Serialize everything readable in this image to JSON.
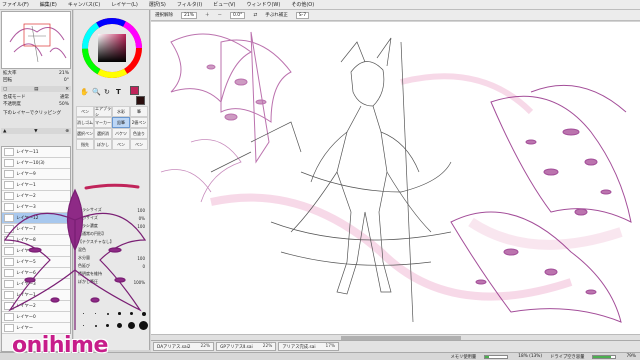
{
  "menu": [
    "ファイル(F)",
    "編集(E)",
    "キャンバス(C)",
    "レイヤー(L)",
    "選択(S)",
    "フィルタ(I)",
    "ビュー(V)",
    "ウィンドウ(W)",
    "その他(O)"
  ],
  "left_panel": {
    "zoom_label": "拡大率",
    "zoom_value": "21%",
    "rotate_label": "回転",
    "rotate_value": "0°",
    "layer_mode_label": "不透明度",
    "opacity_value": "50%",
    "blend_label": "合成モード",
    "blend_value": "通常",
    "clip_label": "下のレイヤーでクリッピング",
    "layers": [
      {
        "name": "レイヤー11",
        "mode": "通常"
      },
      {
        "name": "レイヤー10(3)",
        "mode": "通常"
      },
      {
        "name": "レイヤー9",
        "mode": "通常"
      },
      {
        "name": "レイヤー1",
        "mode": "通常"
      },
      {
        "name": "レイヤー2",
        "mode": "通常"
      },
      {
        "name": "レイヤー3",
        "mode": "通常"
      },
      {
        "name": "レイヤー12",
        "mode": "通常"
      },
      {
        "name": "レイヤー7",
        "mode": "通常"
      },
      {
        "name": "レイヤー8",
        "mode": "通常"
      },
      {
        "name": "レイヤー4",
        "mode": "通常"
      },
      {
        "name": "レイヤー5",
        "mode": "通常"
      },
      {
        "name": "レイヤー6",
        "mode": "通常"
      },
      {
        "name": "レイヤー3",
        "mode": "通常"
      },
      {
        "name": "レイヤー1",
        "mode": "通常"
      },
      {
        "name": "レイヤー2",
        "mode": "通常"
      },
      {
        "name": "レイヤー0",
        "mode": "通常"
      },
      {
        "name": "レイヤー",
        "mode": "通常"
      }
    ]
  },
  "tool_panel": {
    "tools": [
      "ペン",
      "エアブラシ",
      "水彩",
      "筆",
      "消しゴム",
      "マーカー",
      "鉛筆",
      "2値ペン",
      "選択ペン",
      "選択消",
      "バケツ",
      "色塗り",
      "指先",
      "ぼかし",
      "ペン",
      "ペン"
    ],
    "sizes": [
      {
        "label": "ブラシサイズ",
        "value": "100"
      },
      {
        "label": "最小サイズ",
        "value": "0%"
      },
      {
        "label": "ブラシ濃度",
        "value": "100"
      },
      {
        "label": "【通常の円形】",
        "value": ""
      },
      {
        "label": "【テクスチャなし】",
        "value": ""
      },
      {
        "label": "混色",
        "value": ""
      },
      {
        "label": "水分量",
        "value": "100"
      },
      {
        "label": "色延び",
        "value": "0"
      },
      {
        "label": "透明度を維持",
        "value": ""
      },
      {
        "label": "ぼかし筆圧",
        "value": "100%"
      }
    ],
    "main_color": "#c0245a",
    "sub_color": "#2a0e0e"
  },
  "toolbar": {
    "select_source_label": "選択解除",
    "zoom_field": "21%",
    "rotate_field": "0.0°",
    "stabilizer_label": "手ぶれ補正",
    "stabilizer_value": "S-7"
  },
  "files": [
    {
      "name": "DAアリアス.sai2",
      "pct": "22%"
    },
    {
      "name": "GPアリアスⅡ.sai",
      "pct": "22%"
    },
    {
      "name": "アリアス完成.sai",
      "pct": "17%"
    }
  ],
  "status": {
    "memory_label": "メモリ使用量",
    "memory_value": "18% (13%)",
    "memory_fraction": 0.18,
    "drive_label": "ドライブ空き容量",
    "drive_value": "79%",
    "drive_fraction": 0.79
  },
  "watermark": "onihime",
  "colors": {
    "accent": "#c71d8a",
    "sketch": "#b05aa0",
    "lineart": "#444444"
  }
}
